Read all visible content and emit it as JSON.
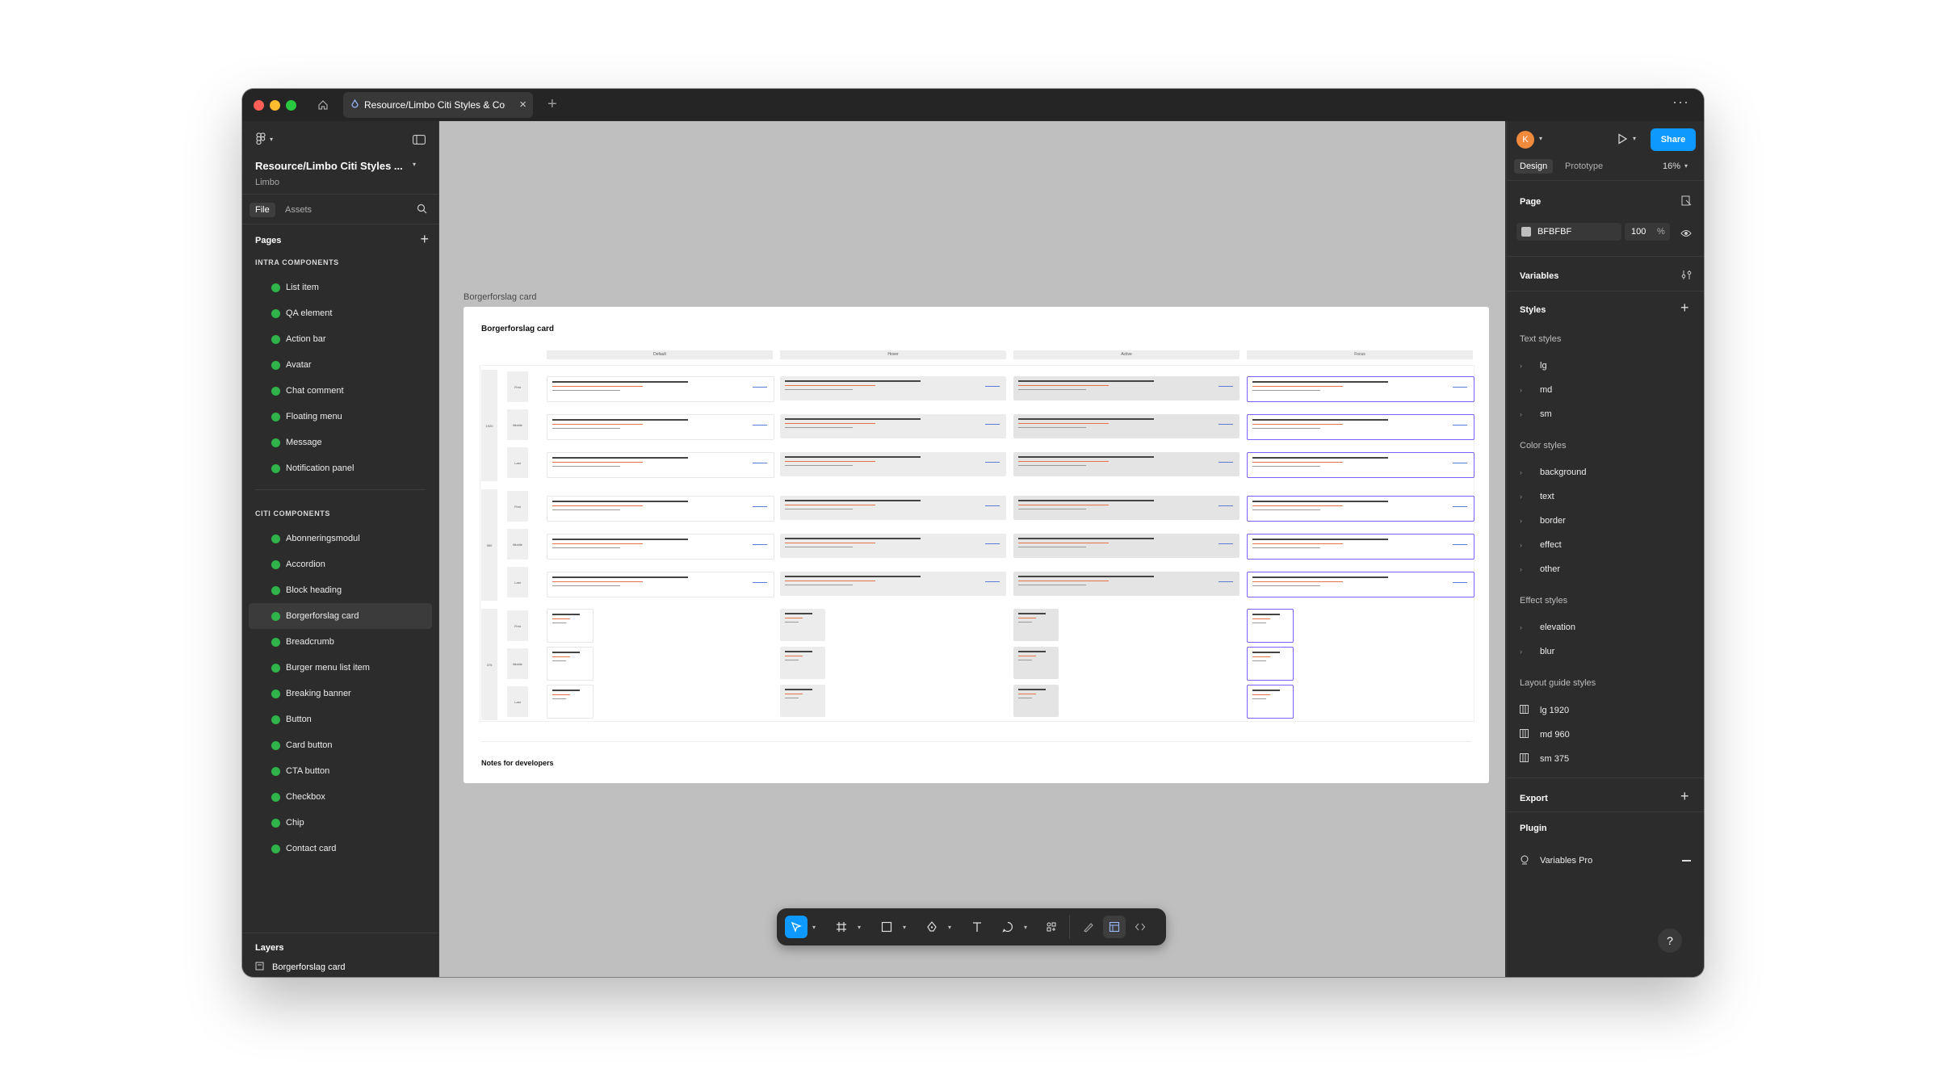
{
  "titlebar": {
    "tab_title": "Resource/Limbo Citi Styles & Cor",
    "home_icon": "home-icon",
    "close_icon": "close-icon",
    "plus": "+",
    "more": "···"
  },
  "left": {
    "file_name": "Resource/Limbo Citi Styles ...",
    "project": "Limbo",
    "tabs": [
      "File",
      "Assets"
    ],
    "pages_title": "Pages",
    "groups": [
      {
        "title": "INTRA COMPONENTS",
        "items": [
          "List item",
          "QA element",
          "Action bar",
          "Avatar",
          "Chat comment",
          "Floating menu",
          "Message",
          "Notification panel"
        ]
      },
      {
        "title": "CITI COMPONENTS",
        "items": [
          "Abonneringsmodul",
          "Accordion",
          "Block heading",
          "Borgerforslag card",
          "Breadcrumb",
          "Burger menu list item",
          "Breaking banner",
          "Button",
          "Card button",
          "CTA button",
          "Checkbox",
          "Chip",
          "Contact card"
        ]
      }
    ],
    "selected_page": "Borgerforslag card",
    "layers_title": "Layers",
    "layer_item": "Borgerforslag card"
  },
  "canvas": {
    "background": "#BFBFBF",
    "frame_label": "Borgerforslag card",
    "frame_title": "Borgerforslag card",
    "notes": "Notes for developers",
    "columns": [
      "Default",
      "Hover",
      "Active",
      "Focus"
    ],
    "row_groups": [
      "1920",
      "960",
      "375"
    ],
    "row_labels": [
      "First",
      "Middle",
      "Last"
    ]
  },
  "right": {
    "avatar_letter": "K",
    "share": "Share",
    "tabs": [
      "Design",
      "Prototype"
    ],
    "zoom": "16%",
    "page_title": "Page",
    "page_color": "BFBFBF",
    "page_opacity": "100",
    "percent": "%",
    "variables": "Variables",
    "styles": "Styles",
    "text_styles_title": "Text styles",
    "text_styles": [
      "lg",
      "md",
      "sm"
    ],
    "color_styles_title": "Color styles",
    "color_styles": [
      "background",
      "text",
      "border",
      "effect",
      "other"
    ],
    "effect_styles_title": "Effect styles",
    "effect_styles": [
      "elevation",
      "blur"
    ],
    "layout_styles_title": "Layout guide styles",
    "layout_styles": [
      "lg 1920",
      "md 960",
      "sm 375"
    ],
    "export": "Export",
    "plugin": "Plugin",
    "plugin_item": "Variables Pro",
    "help": "?"
  },
  "colors": {
    "accent": "#0D99FF",
    "page_dot": "#2FB34A",
    "avatar": "#F08A3C"
  }
}
